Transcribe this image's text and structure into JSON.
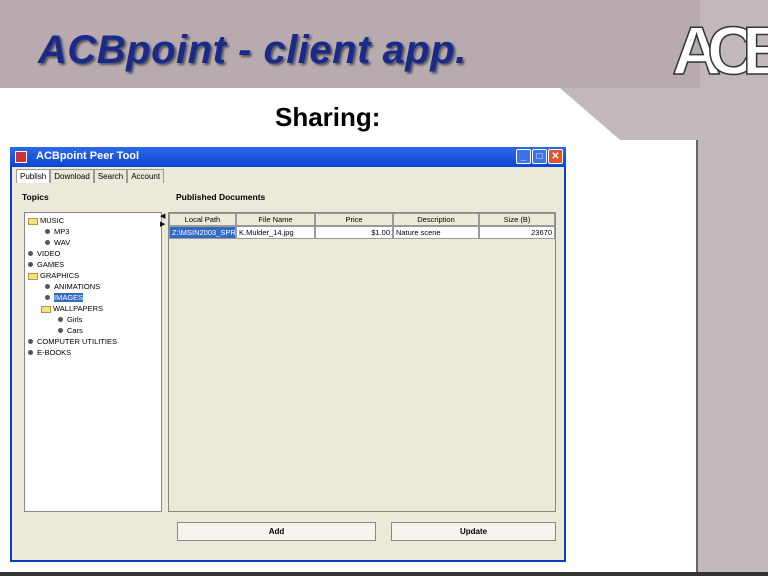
{
  "slide": {
    "title": "ACBpoint - client app.",
    "subtitle": "Sharing:",
    "logo_text": "ACB"
  },
  "window": {
    "title": "ACBpoint Peer Tool",
    "tabs": [
      "Publish",
      "Download",
      "Search",
      "Account"
    ],
    "active_tab": "Publish"
  },
  "topics": {
    "label": "Topics",
    "nodes": [
      {
        "label": "MUSIC",
        "type": "folder",
        "level": 0
      },
      {
        "label": "MP3",
        "type": "leaf",
        "level": 1
      },
      {
        "label": "WAV",
        "type": "leaf",
        "level": 1
      },
      {
        "label": "VIDEO",
        "type": "leaf",
        "level": 0
      },
      {
        "label": "GAMES",
        "type": "leaf",
        "level": 0
      },
      {
        "label": "GRAPHICS",
        "type": "folder",
        "level": 0
      },
      {
        "label": "ANIMATIONS",
        "type": "leaf",
        "level": 1
      },
      {
        "label": "IMAGES",
        "type": "leaf",
        "level": 1,
        "selected": true
      },
      {
        "label": "WALLPAPERS",
        "type": "folder",
        "level": 1
      },
      {
        "label": "Girls",
        "type": "leaf",
        "level": 2
      },
      {
        "label": "Cars",
        "type": "leaf",
        "level": 2
      },
      {
        "label": "COMPUTER UTILITIES",
        "type": "leaf",
        "level": 0
      },
      {
        "label": "E-BOOKS",
        "type": "leaf",
        "level": 0
      }
    ]
  },
  "documents": {
    "label": "Published Documents",
    "columns": [
      "Local Path",
      "File Name",
      "Price",
      "Description",
      "Size (B)"
    ],
    "rows": [
      [
        "Z:\\MSIN2003_SPR...",
        "K.Mulder_14.jpg",
        "$1.00",
        "Nature scene",
        "23670"
      ]
    ]
  },
  "buttons": {
    "add": "Add",
    "update": "Update"
  }
}
